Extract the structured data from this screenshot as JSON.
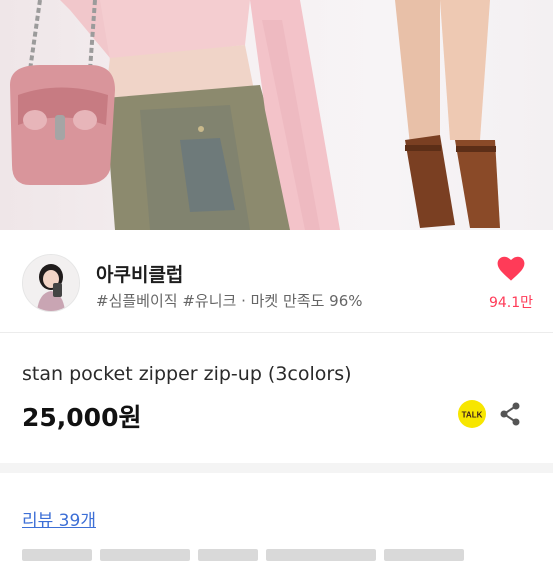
{
  "hero": {
    "image_description": ""
  },
  "shop": {
    "name": "아쿠비클럽",
    "tags": "#심플베이직 #유니크 · 마켓 만족도 96%",
    "like_count": "94.1만"
  },
  "product": {
    "title": "stan pocket zipper zip-up (3colors)",
    "price": "25,000원",
    "talk_label": "TALK"
  },
  "reviews": {
    "link_text": "리뷰 39개"
  },
  "colors": {
    "like_red": "#ff3b58",
    "link_blue": "#3d6fd6",
    "talk_yellow": "#f7e600"
  }
}
